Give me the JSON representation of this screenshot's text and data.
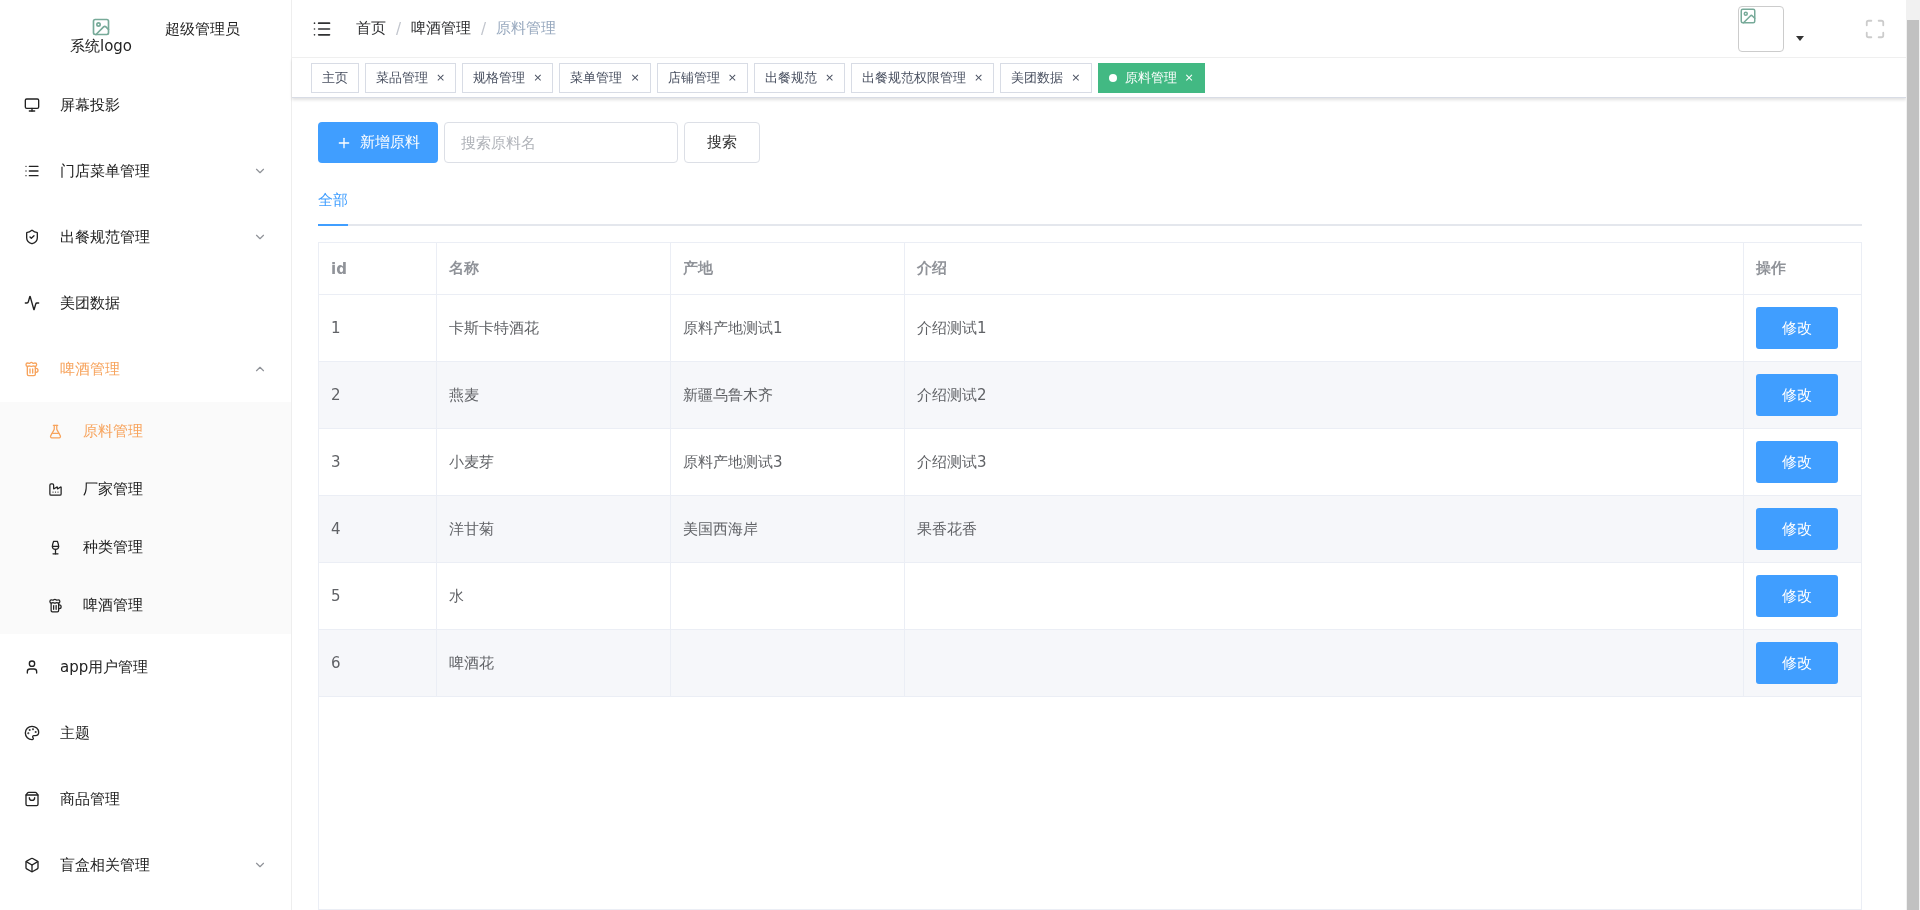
{
  "sidebar": {
    "logo_alt": "系统logo",
    "user": "超级管理员",
    "items": [
      {
        "label": "屏幕投影",
        "selected": false
      },
      {
        "label": "门店菜单管理",
        "expanded": false,
        "selected": false
      },
      {
        "label": "出餐规范管理",
        "expanded": false,
        "selected": false
      },
      {
        "label": "美团数据",
        "selected": false
      },
      {
        "label": "啤酒管理",
        "expanded": true,
        "selected": true,
        "children": [
          {
            "label": "原料管理",
            "selected": true
          },
          {
            "label": "厂家管理",
            "selected": false
          },
          {
            "label": "种类管理",
            "selected": false
          },
          {
            "label": "啤酒管理",
            "selected": false
          }
        ]
      },
      {
        "label": "app用户管理",
        "selected": false
      },
      {
        "label": "主题",
        "selected": false
      },
      {
        "label": "商品管理",
        "selected": false
      },
      {
        "label": "盲盒相关管理",
        "expanded": false,
        "selected": false
      }
    ]
  },
  "breadcrumb": [
    {
      "label": "首页"
    },
    {
      "separator": "/",
      "label": "啤酒管理"
    },
    {
      "separator": "/",
      "label": "原料管理"
    }
  ],
  "tags": [
    {
      "label": "主页",
      "selected": false
    },
    {
      "label": "菜品管理",
      "close": "×",
      "selected": false
    },
    {
      "label": "规格管理",
      "close": "×",
      "selected": false
    },
    {
      "label": "菜单管理",
      "close": "×",
      "selected": false
    },
    {
      "label": "店铺管理",
      "close": "×",
      "selected": false
    },
    {
      "label": "出餐规范",
      "close": "×",
      "selected": false
    },
    {
      "label": "出餐规范权限管理",
      "close": "×",
      "selected": false
    },
    {
      "label": "美团数据",
      "close": "×",
      "selected": false
    },
    {
      "label": "原料管理",
      "close": "×",
      "selected": true
    }
  ],
  "toolbar": {
    "add_button": "新增原料",
    "search": {
      "placeholder": "搜索原料名"
    },
    "search_button": "搜索"
  },
  "tabs": [
    {
      "label": "全部",
      "selected": true
    }
  ],
  "table": {
    "columns": [
      "id",
      "名称",
      "产地",
      "介绍",
      "操作"
    ],
    "rows": [
      {
        "cells": [
          "1",
          "卡斯卡特酒花",
          "原料产地测试1",
          "介绍测试1"
        ],
        "action": "修改"
      },
      {
        "cells": [
          "2",
          "燕麦",
          "新疆乌鲁木齐",
          "介绍测试2"
        ],
        "action": "修改"
      },
      {
        "cells": [
          "3",
          "小麦芽",
          "原料产地测试3",
          "介绍测试3"
        ],
        "action": "修改"
      },
      {
        "cells": [
          "4",
          "洋甘菊",
          "美国西海岸",
          "果香花香"
        ],
        "action": "修改"
      },
      {
        "cells": [
          "5",
          "水",
          "",
          ""
        ],
        "action": "修改"
      },
      {
        "cells": [
          "6",
          "啤酒花",
          "",
          ""
        ],
        "action": "修改"
      }
    ]
  }
}
